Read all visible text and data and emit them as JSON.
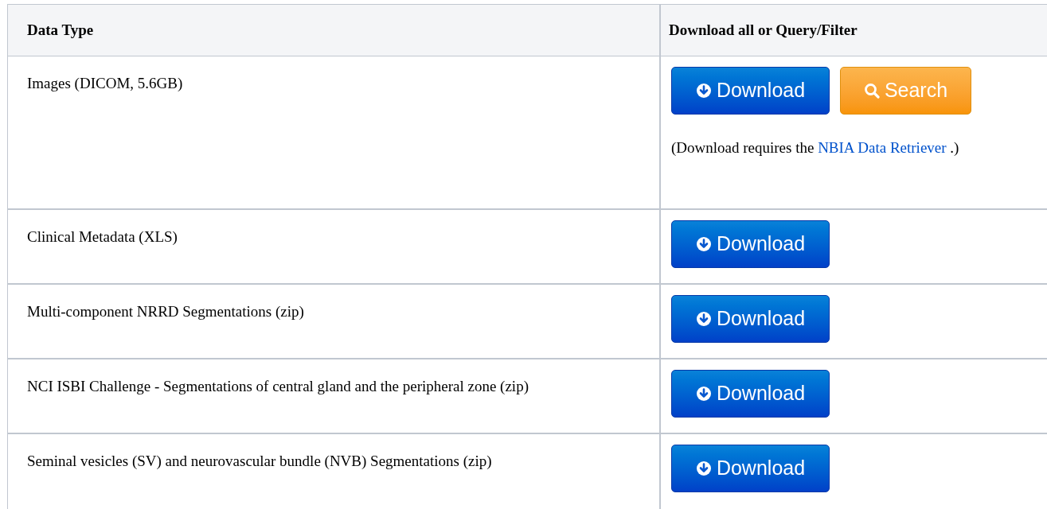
{
  "table": {
    "columns": [
      "Data Type",
      "Download all or Query/Filter"
    ],
    "rows": [
      {
        "data_type": "Images (DICOM, 5.6GB)",
        "actions": [
          {
            "kind": "download",
            "label": "Download"
          },
          {
            "kind": "search",
            "label": "Search"
          }
        ],
        "note": {
          "before": "(Download requires the ",
          "link": "NBIA Data Retriever",
          "after": " .)"
        }
      },
      {
        "data_type": "Clinical Metadata (XLS)",
        "actions": [
          {
            "kind": "download",
            "label": "Download"
          }
        ]
      },
      {
        "data_type": "Multi-component NRRD Segmentations (zip)",
        "actions": [
          {
            "kind": "download",
            "label": "Download"
          }
        ]
      },
      {
        "data_type": "NCI ISBI Challenge - Segmentations of central gland and the peripheral zone (zip)",
        "actions": [
          {
            "kind": "download",
            "label": "Download"
          }
        ]
      },
      {
        "data_type": "Seminal vesicles (SV) and neurovascular bundle (NVB) Segmentations (zip)",
        "actions": [
          {
            "kind": "download",
            "label": "Download"
          }
        ]
      }
    ]
  }
}
